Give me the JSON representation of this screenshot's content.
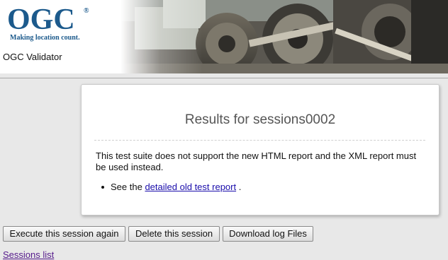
{
  "header": {
    "logo_text": "OGC",
    "logo_registered": "®",
    "logo_tagline": "Making location count.",
    "app_title": "OGC Validator"
  },
  "results": {
    "title": "Results for sessions0002",
    "message": "This test suite does not support the new HTML report and the XML report must be used instead.",
    "list_prefix": "See the",
    "report_link": "detailed old test report",
    "list_suffix": "."
  },
  "actions": {
    "execute_again": "Execute this session again",
    "delete": "Delete this session",
    "download_logs": "Download log Files"
  },
  "footer": {
    "sessions_list": "Sessions list"
  },
  "colors": {
    "brand": "#1c5a8c",
    "link": "#1a0dab",
    "visited_link": "#551a8b",
    "page_background": "#e8e8e8"
  }
}
